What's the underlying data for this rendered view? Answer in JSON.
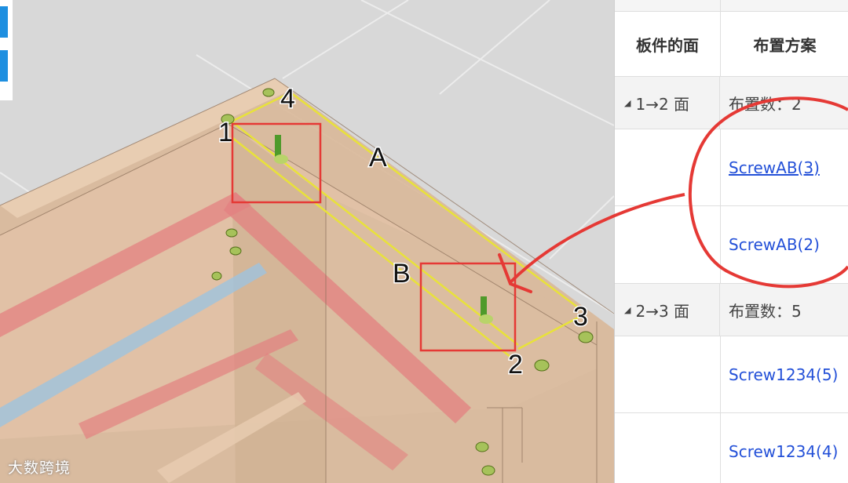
{
  "table": {
    "headers": {
      "face": "板件的面",
      "scheme": "布置方案"
    },
    "groups": [
      {
        "face": "1→2 面",
        "count": "布置数：2",
        "items": [
          "ScrewAB(3)",
          "ScrewAB(2)"
        ]
      },
      {
        "face": "2→3 面",
        "count": "布置数：5",
        "items": [
          "Screw1234(5)",
          "Screw1234(4)"
        ]
      }
    ]
  },
  "viewport": {
    "labels": {
      "p1": "1",
      "p2": "2",
      "p3": "3",
      "p4": "4",
      "edge_a": "A",
      "edge_b": "B"
    }
  },
  "watermark": "大数跨境",
  "colors": {
    "highlight_box": "#e53935",
    "annotation": "#e53935",
    "link": "#2350d8",
    "guide_line": "#e8e23a"
  }
}
